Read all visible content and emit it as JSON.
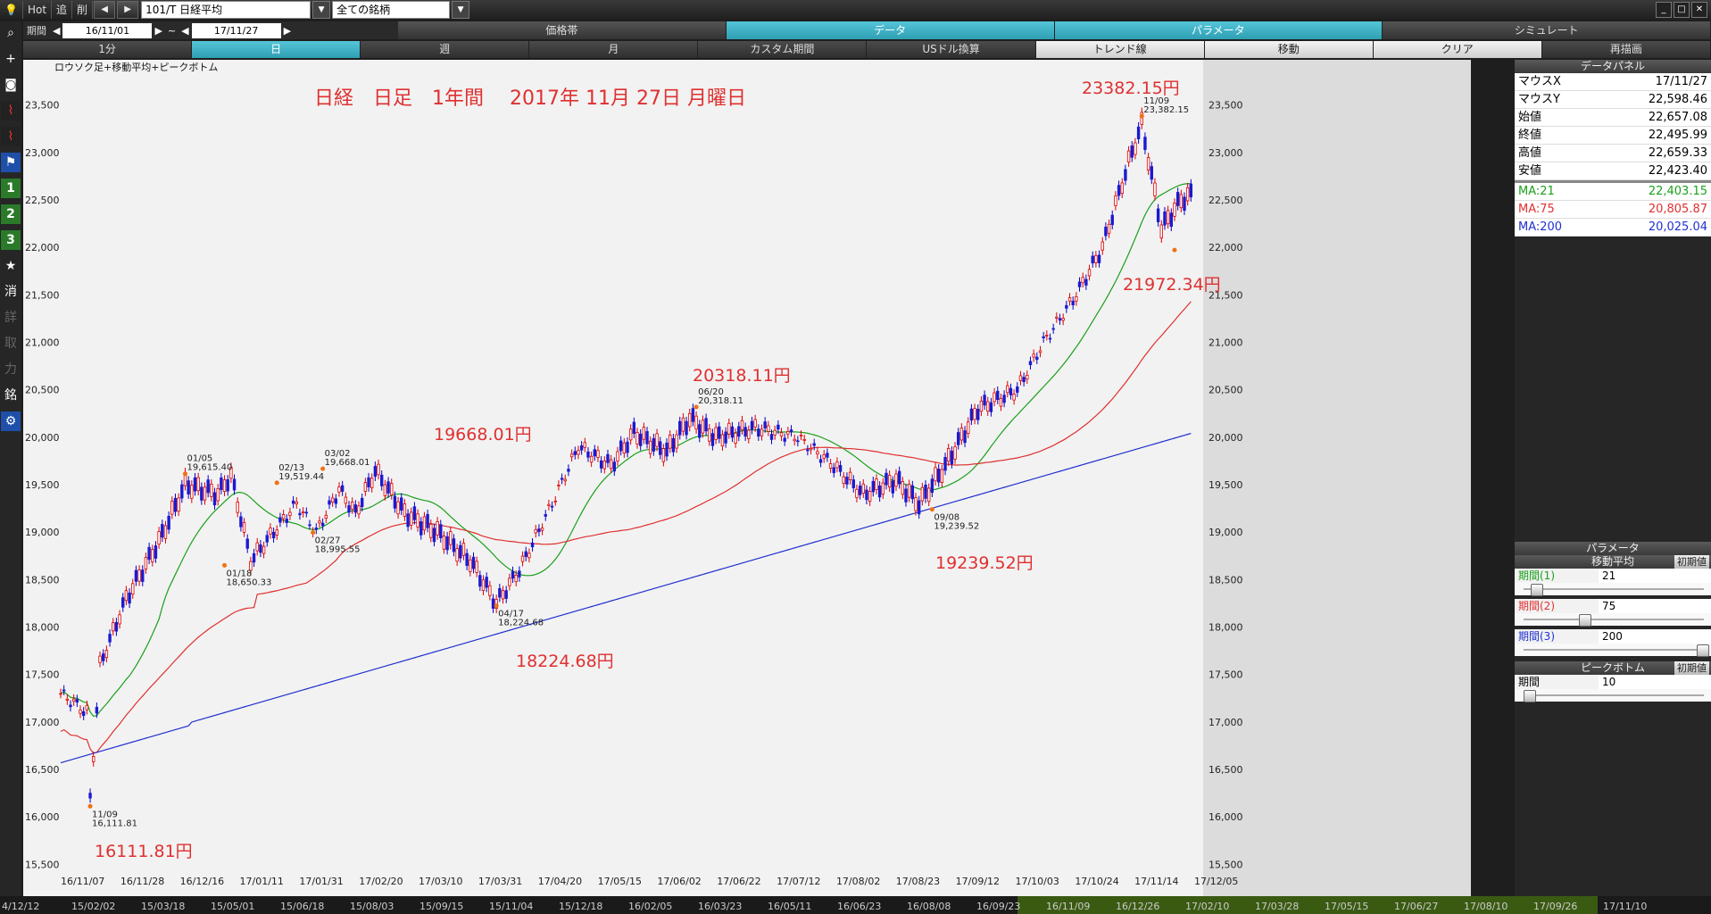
{
  "toolbar": {
    "hot": "Hot",
    "fwd": "追",
    "del": "削",
    "symbol": "101/T 日経平均",
    "universe": "全ての銘柄",
    "period_label": "期間",
    "date_from": "16/11/01",
    "tilde": "~",
    "date_to": "17/11/27"
  },
  "tabs_row1": [
    "価格帯",
    "データ",
    "パラメータ",
    "シミュレート"
  ],
  "tabs_row2": [
    "1分",
    "日",
    "週",
    "月",
    "カスタム期間",
    "USドル換算",
    "トレンド線",
    "移動",
    "クリア",
    "再描画"
  ],
  "side_icons": [
    "search-icon",
    "crosshair-icon",
    "camera-icon",
    "line-chart-icon",
    "line-chart-icon",
    "flag-icon",
    "1",
    "2",
    "3",
    "★",
    "消",
    "詳",
    "取",
    "力",
    "銘",
    "gear-icon"
  ],
  "chart_data": {
    "type": "candlestick",
    "subtitle": "ロウソク足+移動平均+ピークボトム",
    "title": "日経　日足　1年間　 2017年 11月 27日 月曜日",
    "ylim": [
      15500,
      23700
    ],
    "y_ticks": [
      "15,500",
      "16,000",
      "16,500",
      "17,000",
      "17,500",
      "18,000",
      "18,500",
      "19,000",
      "19,500",
      "20,000",
      "20,500",
      "21,000",
      "21,500",
      "22,000",
      "22,500",
      "23,000",
      "23,500"
    ],
    "x_ticks": [
      "16/11/07",
      "16/11/28",
      "16/12/16",
      "17/01/11",
      "17/01/31",
      "17/02/20",
      "17/03/10",
      "17/03/31",
      "17/04/20",
      "17/05/15",
      "17/06/02",
      "17/06/22",
      "17/07/12",
      "17/08/02",
      "17/08/23",
      "17/09/12",
      "17/10/03",
      "17/10/24",
      "17/11/14",
      "17/12/05"
    ],
    "ma_series": [
      {
        "name": "MA:21",
        "color": "#1aa01a"
      },
      {
        "name": "MA:75",
        "color": "#e03030"
      },
      {
        "name": "MA:200",
        "color": "#2030d0"
      }
    ],
    "peaks": [
      {
        "date": "11/09",
        "value": "16,111.81",
        "big": "16111.81円"
      },
      {
        "date": "01/05",
        "value": "19,615.40",
        "big": ""
      },
      {
        "date": "01/18",
        "value": "18,650.33",
        "big": ""
      },
      {
        "date": "02/13",
        "value": "19,519.44",
        "big": ""
      },
      {
        "date": "02/27",
        "value": "18,995.55",
        "big": ""
      },
      {
        "date": "03/02",
        "value": "19,668.01",
        "big": "19668.01円"
      },
      {
        "date": "04/17",
        "value": "18,224.68",
        "big": "18224.68円"
      },
      {
        "date": "06/20",
        "value": "20,318.11",
        "big": "20318.11円"
      },
      {
        "date": "09/08",
        "value": "19,239.52",
        "big": "19239.52円"
      },
      {
        "date": "11/09",
        "value": "23,382.15",
        "big": "23382.15円"
      },
      {
        "date": "",
        "value": "",
        "big": "21972.34円"
      }
    ]
  },
  "data_panel": {
    "title": "データパネル",
    "rows": [
      {
        "k": "マウスX",
        "v": "17/11/27",
        "color": "#000"
      },
      {
        "k": "マウスY",
        "v": "22,598.46",
        "color": "#000"
      },
      {
        "k": "始値",
        "v": "22,657.08",
        "color": "#000"
      },
      {
        "k": "終値",
        "v": "22,495.99",
        "color": "#000"
      },
      {
        "k": "高値",
        "v": "22,659.33",
        "color": "#000"
      },
      {
        "k": "安値",
        "v": "22,423.40",
        "color": "#000"
      },
      {
        "k": "MA:21",
        "v": "22,403.15",
        "color": "#1aa01a"
      },
      {
        "k": "MA:75",
        "v": "20,805.87",
        "color": "#e03030"
      },
      {
        "k": "MA:200",
        "v": "20,025.04",
        "color": "#2030d0"
      }
    ]
  },
  "param_panel": {
    "title": "パラメータ",
    "ma_title": "移動平均",
    "reset": "初期値",
    "p1_label": "期間(1)",
    "p1": "21",
    "p2_label": "期間(2)",
    "p2": "75",
    "p3_label": "期間(3)",
    "p3": "200",
    "pb_title": "ピークボトム",
    "pb_label": "期間",
    "pb": "10"
  },
  "bottom_ticks": [
    "4/12/12",
    "15/02/02",
    "15/03/18",
    "15/05/01",
    "15/06/18",
    "15/08/03",
    "15/09/15",
    "15/11/04",
    "15/12/18",
    "16/02/05",
    "16/03/23",
    "16/05/11",
    "16/06/23",
    "16/08/08",
    "16/09/23",
    "16/11/09",
    "16/12/26",
    "17/02/10",
    "17/03/28",
    "17/05/15",
    "17/06/27",
    "17/08/10",
    "17/09/26",
    "17/11/10"
  ]
}
